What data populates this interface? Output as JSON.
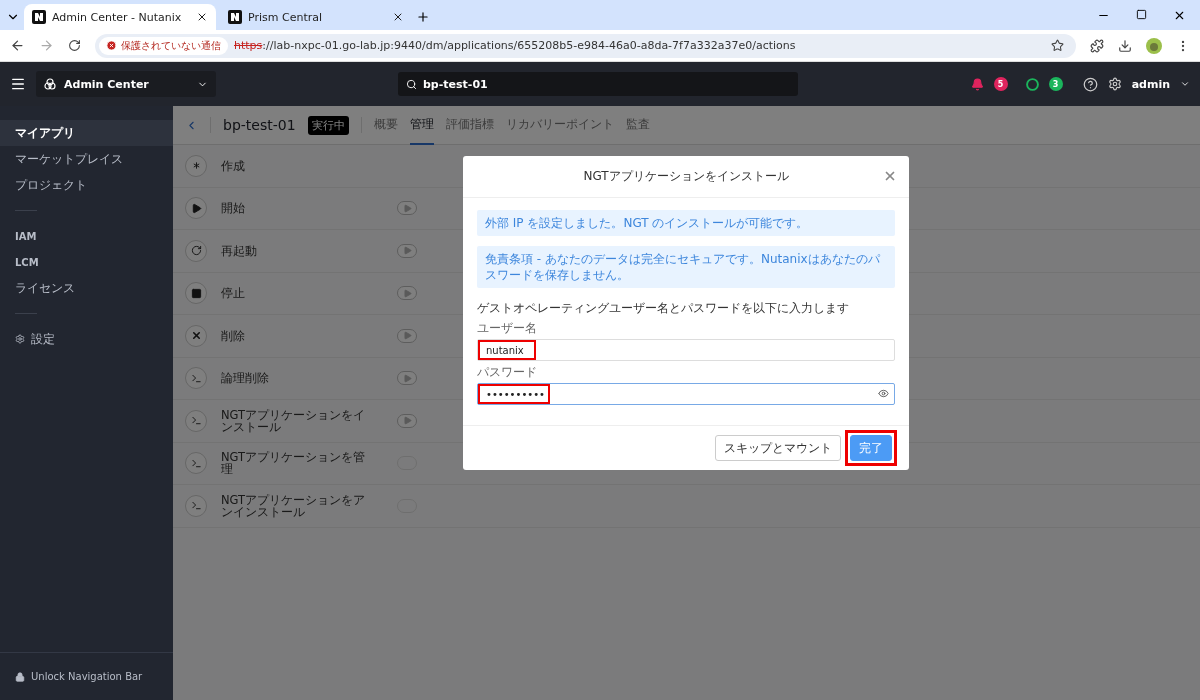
{
  "browser": {
    "tabs": [
      {
        "title": "Admin Center - Nutanix",
        "selected": true
      },
      {
        "title": "Prism Central",
        "selected": false
      }
    ],
    "security_label": "保護されていない通信",
    "url_scheme": "https",
    "url_rest": "://lab-nxpc-01.go-lab.jp:9440/dm/applications/655208b5-e984-46a0-a8da-7f7a332a37e0/actions"
  },
  "header": {
    "app_switcher": "Admin Center",
    "search": {
      "value": "bp-test-01"
    },
    "alerts_count": "5",
    "tasks_count": "3",
    "user": "admin"
  },
  "sidebar": {
    "sections": [
      {
        "items": [
          {
            "label": "マイアプリ",
            "kind": "link",
            "selected": true
          },
          {
            "label": "マーケットプレイス",
            "kind": "link",
            "selected": false
          },
          {
            "label": "プロジェクト",
            "kind": "link",
            "selected": false
          }
        ]
      },
      {
        "items": [
          {
            "label": "IAM",
            "kind": "caps",
            "selected": false
          },
          {
            "label": "LCM",
            "kind": "caps",
            "selected": false
          },
          {
            "label": "ライセンス",
            "kind": "link",
            "selected": false
          }
        ]
      },
      {
        "items": [
          {
            "label": "設定",
            "kind": "settings",
            "selected": false
          }
        ]
      }
    ],
    "footer": "Unlock Navigation Bar"
  },
  "app": {
    "name": "bp-test-01",
    "status": "実行中",
    "tabs": [
      {
        "label": "概要",
        "selected": false
      },
      {
        "label": "管理",
        "selected": true
      },
      {
        "label": "評価指標",
        "selected": false
      },
      {
        "label": "リカバリーポイント",
        "selected": false
      },
      {
        "label": "監査",
        "selected": false
      }
    ],
    "actions": [
      {
        "label": "作成",
        "kind": "sparkle",
        "has_run_button": false
      },
      {
        "label": "開始",
        "kind": "play",
        "has_run_button": true,
        "runnable": true
      },
      {
        "label": "再起動",
        "kind": "restart",
        "has_run_button": true,
        "runnable": true
      },
      {
        "label": "停止",
        "kind": "stop",
        "has_run_button": true,
        "runnable": true
      },
      {
        "label": "削除",
        "kind": "delete",
        "has_run_button": true,
        "runnable": true
      },
      {
        "label": "論理削除",
        "kind": "terminal",
        "has_run_button": true,
        "runnable": true
      },
      {
        "label": "NGTアプリケーションをインストール",
        "kind": "terminal",
        "has_run_button": true,
        "runnable": true
      },
      {
        "label": "NGTアプリケーションを管理",
        "kind": "terminal",
        "has_run_button": true,
        "runnable": false
      },
      {
        "label": "NGTアプリケーションをアンインストール",
        "kind": "terminal",
        "has_run_button": true,
        "runnable": false
      }
    ]
  },
  "dialog": {
    "title": "NGTアプリケーションをインストール",
    "notices": [
      "外部 IP を設定しました。NGT のインストールが可能です。",
      "免責条項 - あなたのデータは完全にセキュアです。Nutanixはあなたのパスワードを保存しません。"
    ],
    "instruction": "ゲストオペレーティングユーザー名とパスワードを以下に入力します",
    "fields": [
      {
        "label": "ユーザー名",
        "value": "nutanix",
        "kind": "text",
        "focused": false,
        "highlighted": true
      },
      {
        "label": "パスワード",
        "value": "••••••••••",
        "kind": "password",
        "focused": true,
        "highlighted": true
      }
    ],
    "buttons": [
      {
        "label": "スキップとマウント",
        "kind": "secondary",
        "highlighted": false
      },
      {
        "label": "完了",
        "kind": "primary",
        "highlighted": true
      }
    ]
  }
}
